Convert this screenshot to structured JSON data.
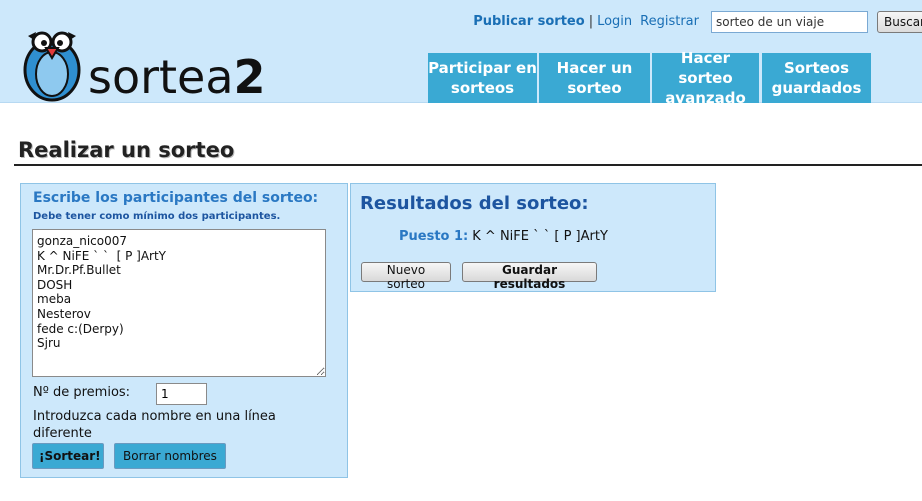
{
  "header": {
    "brand_light": "sortea",
    "brand_bold": "2",
    "links": {
      "publish": "Publicar sorteo",
      "separator": "|",
      "login": "Login",
      "register": "Registrar"
    },
    "search": {
      "value": "sorteo de un viaje",
      "button_label": "Buscar"
    },
    "nav": [
      {
        "label": "Participar en sorteos"
      },
      {
        "label": "Hacer un sorteo"
      },
      {
        "label": "Hacer sorteo avanzado"
      },
      {
        "label": "Sorteos guardados"
      }
    ],
    "colors": {
      "header_bg": "#cde8fb",
      "nav_bg": "#3aa9d3",
      "link": "#1a6fb5"
    }
  },
  "page": {
    "title": "Realizar un sorteo"
  },
  "form": {
    "heading": "Escribe los participantes del sorteo:",
    "subheading": "Debe tener como mínimo dos participantes.",
    "participants": "gonza_nico007\nK ^ NiFE ` `  [ P ]ArtY\nMr.Dr.Pf.Bullet\nDOSH\nmeba\nNesterov\nfede c:(Derpy)\nSjru",
    "prizes_label": "Nº de premios:",
    "prizes_value": "1",
    "hint": "Introduzca cada nombre en una línea diferente",
    "draw_button": "¡Sortear!",
    "clear_button": "Borrar nombres"
  },
  "results": {
    "heading": "Resultados del sorteo:",
    "items": [
      {
        "label": "Puesto 1:",
        "name": "K ^ NiFE ` `  [ P ]ArtY"
      }
    ],
    "new_button": "Nuevo sorteo",
    "save_button": "Guardar resultados"
  }
}
